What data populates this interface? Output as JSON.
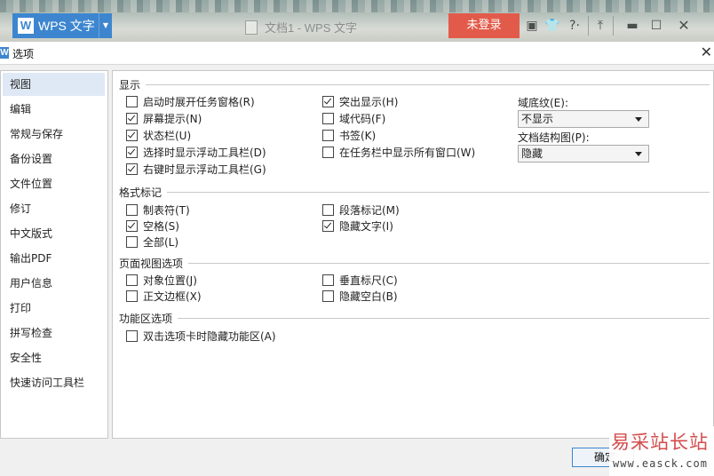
{
  "app": {
    "name": "WPS 文字",
    "logo_letter": "W",
    "document_title": "文档1 - WPS 文字",
    "login_label": "未登录",
    "help_label": "?·"
  },
  "colors": {
    "accent": "#3d86cf",
    "login": "#e25b4a",
    "nav_active": "#dfe8f5"
  },
  "dialog": {
    "title": "选项",
    "close_glyph": "✕",
    "ok_label": "确定"
  },
  "nav": {
    "items": [
      {
        "label": "视图",
        "active": true
      },
      {
        "label": "编辑"
      },
      {
        "label": "常规与保存"
      },
      {
        "label": "备份设置"
      },
      {
        "label": "文件位置"
      },
      {
        "label": "修订"
      },
      {
        "label": "中文版式"
      },
      {
        "label": "输出PDF"
      },
      {
        "label": "用户信息"
      },
      {
        "label": "打印"
      },
      {
        "label": "拼写检查"
      },
      {
        "label": "安全性"
      },
      {
        "label": "快速访问工具栏"
      }
    ]
  },
  "sections": {
    "display": {
      "title": "显示",
      "options": [
        {
          "label": "启动时展开任务窗格(R)",
          "checked": false
        },
        {
          "label": "屏幕提示(N)",
          "checked": true
        },
        {
          "label": "状态栏(U)",
          "checked": true
        },
        {
          "label": "选择时显示浮动工具栏(D)",
          "checked": true
        },
        {
          "label": "右键时显示浮动工具栏(G)",
          "checked": true
        },
        {
          "label": "突出显示(H)",
          "checked": true
        },
        {
          "label": "域代码(F)",
          "checked": false
        },
        {
          "label": "书签(K)",
          "checked": false
        },
        {
          "label": "在任务栏中显示所有窗口(W)",
          "checked": false
        }
      ],
      "field_shading": {
        "label": "域底纹(E):",
        "value": "不显示"
      },
      "doc_map": {
        "label": "文档结构图(P):",
        "value": "隐藏"
      }
    },
    "format_marks": {
      "title": "格式标记",
      "options": [
        {
          "label": "制表符(T)",
          "checked": false
        },
        {
          "label": "空格(S)",
          "checked": true
        },
        {
          "label": "全部(L)",
          "checked": false
        },
        {
          "label": "段落标记(M)",
          "checked": false
        },
        {
          "label": "隐藏文字(I)",
          "checked": true
        }
      ]
    },
    "page_view": {
      "title": "页面视图选项",
      "options": [
        {
          "label": "对象位置(J)",
          "checked": false
        },
        {
          "label": "正文边框(X)",
          "checked": false
        },
        {
          "label": "垂直标尺(C)",
          "checked": false
        },
        {
          "label": "隐藏空白(B)",
          "checked": false
        }
      ]
    },
    "ribbon": {
      "title": "功能区选项",
      "options": [
        {
          "label": "双击选项卡时隐藏功能区(A)",
          "checked": false
        }
      ]
    }
  },
  "watermark": {
    "text": "易采站长站",
    "url": "www.easck.com"
  }
}
